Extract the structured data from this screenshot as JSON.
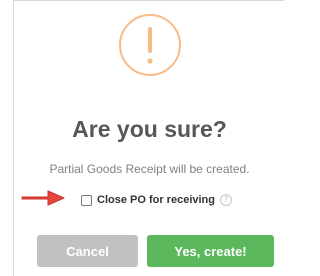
{
  "dialog": {
    "icon": "exclamation-circle-icon",
    "title": "Are you sure?",
    "message": "Partial Goods Receipt will be created.",
    "checkbox": {
      "label": "Close PO for receiving",
      "checked": false,
      "help_icon": "question-circle-icon",
      "help_glyph": "?"
    },
    "buttons": {
      "cancel_label": "Cancel",
      "confirm_label": "Yes, create!"
    }
  },
  "annotation": {
    "icon": "red-arrow-icon"
  },
  "colors": {
    "warning_ring": "#f8bb86",
    "title_text": "#575757",
    "message_text": "#808080",
    "cancel_button": "#c1c1c1",
    "confirm_button": "#5cb85c",
    "arrow": "#e8453c"
  }
}
